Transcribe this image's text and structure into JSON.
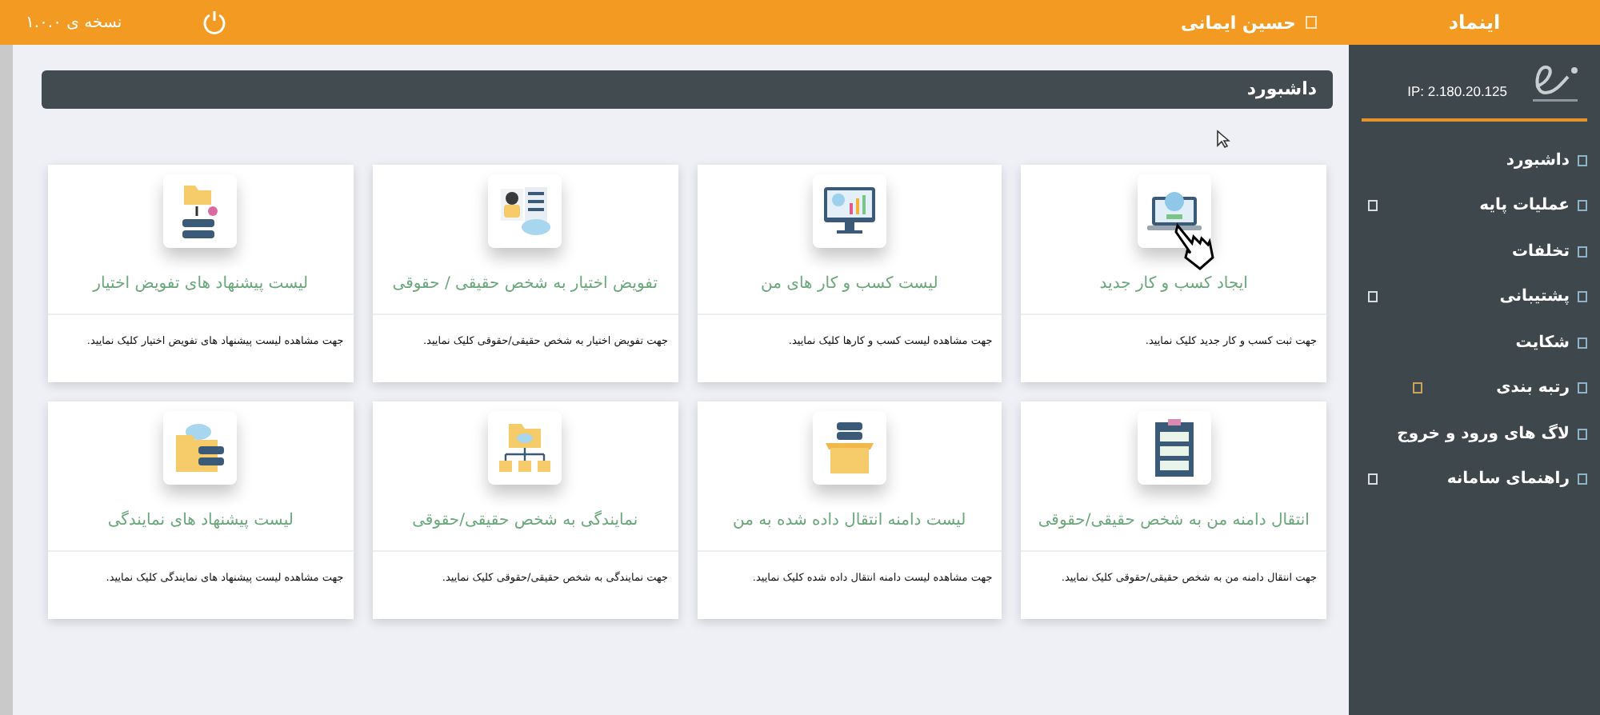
{
  "top_bar": {
    "brand": "اینماد",
    "user": "حسین ایمانی",
    "version": "نسخه ی ۱.۰.۰"
  },
  "sidebar": {
    "ip": "IP: 2.180.20.125",
    "items": [
      {
        "label": "داشبورد",
        "kind": "link"
      },
      {
        "label": "عملیات پایه",
        "kind": "group"
      },
      {
        "label": "تخلفات",
        "kind": "link"
      },
      {
        "label": "پشتیبانی",
        "kind": "group"
      },
      {
        "label": "شکایت",
        "kind": "link"
      },
      {
        "label": "رتبه بندی",
        "kind": "subgroup"
      },
      {
        "label": "لاگ های ورود و خروج",
        "kind": "link"
      },
      {
        "label": "راهنمای سامانه",
        "kind": "group"
      }
    ]
  },
  "breadcrumb": "داشبورد",
  "cards": [
    {
      "title": "ایجاد کسب و کار جدید",
      "description": "جهت ثبت کسب و کار جدید کلیک نمایید."
    },
    {
      "title": "لیست کسب و کار های من",
      "description": "جهت مشاهده لیست کسب و کارها کلیک نمایید."
    },
    {
      "title": "تفویض اختیار به شخص حقیقی / حقوقی",
      "description": "جهت تفویض اختیار به شخص حقیقی/حقوقی کلیک نمایید."
    },
    {
      "title": "لیست پیشنهاد های تفویض اختیار",
      "description": "جهت مشاهده لیست پیشنهاد های تفویض اختیار کلیک نمایید."
    },
    {
      "title": "انتقال دامنه من به شخص حقیقی/حقوقی",
      "description": "جهت انتقال دامنه من به شخص حقیقی/حقوقی کلیک نمایید."
    },
    {
      "title": "لیست دامنه انتقال داده شده به من",
      "description": "جهت مشاهده لیست دامنه انتقال داده شده کلیک نمایید."
    },
    {
      "title": "نمایندگی به شخص حقیقی/حقوقی",
      "description": "جهت نمایندگی به شخص حقیقی/حقوقی کلیک نمایید."
    },
    {
      "title": "لیست پیشنهاد های نمایندگی",
      "description": "جهت مشاهده لیست پیشنهاد های نمایندگی کلیک نمایید."
    }
  ]
}
